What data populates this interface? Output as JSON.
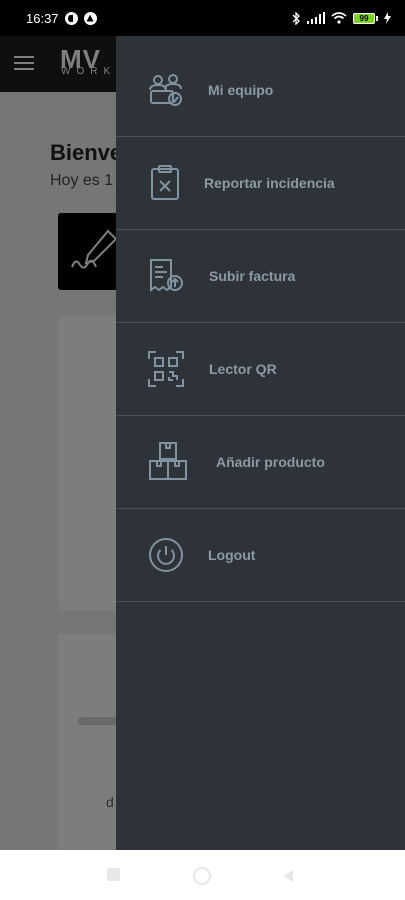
{
  "status_bar": {
    "time": "16:37",
    "battery": "99"
  },
  "background_app": {
    "logo": "MV",
    "logo_sub": "WORK",
    "welcome": "Bienve",
    "today": "Hoy es 1",
    "card_text": "d"
  },
  "drawer": {
    "items": [
      {
        "label": "Mi equipo",
        "icon": "team-icon"
      },
      {
        "label": "Reportar incidencia",
        "icon": "clipboard-x-icon"
      },
      {
        "label": "Subir factura",
        "icon": "invoice-upload-icon"
      },
      {
        "label": "Lector QR",
        "icon": "qr-scanner-icon"
      },
      {
        "label": "Añadir producto",
        "icon": "boxes-icon"
      },
      {
        "label": "Logout",
        "icon": "power-icon"
      }
    ]
  },
  "colors": {
    "drawer_bg": "#2d3339",
    "drawer_text": "#8a9aa6",
    "divider": "#4b5258",
    "icon_stroke": "#7f93a1"
  }
}
